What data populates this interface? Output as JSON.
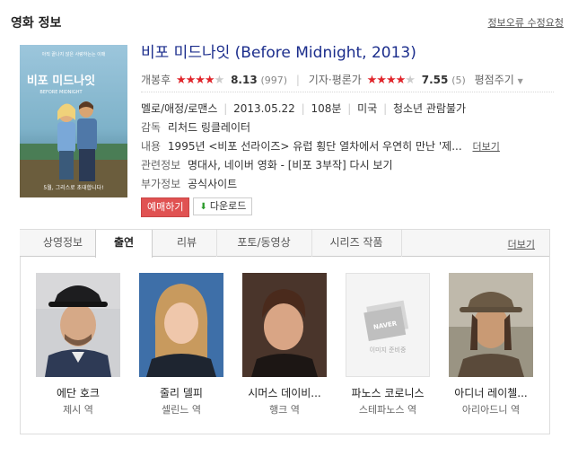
{
  "section": {
    "title": "영화 정보",
    "report_link": "정보오류 수정요청"
  },
  "movie": {
    "title": "비포 미드나잇 (Before Midnight, 2013)",
    "poster": {
      "tagline": "아직 끝나지 않은 사랑하는는 이매",
      "title_ko": "비포 미드나잇",
      "title_en": "BEFORE MIDNIGHT",
      "bottom_text": "5월, 그리스로 초대합니다!"
    },
    "audience_rating": {
      "label": "개봉후",
      "stars": 4,
      "score": "8.13",
      "count": "(997)"
    },
    "critic_rating": {
      "label": "기자·평론가",
      "stars": 4,
      "score": "7.55",
      "count": "(5)"
    },
    "rate_link": "평점주기",
    "genre": "멜로/애정/로맨스",
    "release_date": "2013.05.22",
    "runtime": "108분",
    "country": "미국",
    "age_rating": "청소년 관람불가",
    "director_label": "감독",
    "director": "리처드 링클레이터",
    "plot_label": "내용",
    "plot": "1995년 <비포 선라이즈> 유럽 횡단 열차에서 우연히 만난 '제...",
    "plot_more": "더보기",
    "related_label": "관련정보",
    "related": [
      "명대사",
      "네이버 영화 - [비포 3부작] 다시 보기"
    ],
    "extra_label": "부가정보",
    "extra": "공식사이트",
    "buttons": {
      "reserve": "예매하기",
      "download": "다운로드"
    }
  },
  "tabs": {
    "items": [
      "상영정보",
      "출연",
      "리뷰",
      "포토/동영상",
      "시리즈 작품"
    ],
    "active": "출연",
    "more": "더보기"
  },
  "cast": [
    {
      "name": "에단 호크",
      "role": "제시 역"
    },
    {
      "name": "줄리 델피",
      "role": "셀린느 역"
    },
    {
      "name": "시머스 데이비...",
      "role": "행크 역"
    },
    {
      "name": "파노스 코로니스",
      "role": "스테파노스 역"
    },
    {
      "name": "아디너 레이첼...",
      "role": "아리아드니 역"
    }
  ],
  "placeholder_text": {
    "logo": "NAVER",
    "caption": "이미지 준비중"
  },
  "colors": {
    "title": "#1b2d8c",
    "stars": "#e0242a",
    "reserve_button": "#e05252"
  }
}
